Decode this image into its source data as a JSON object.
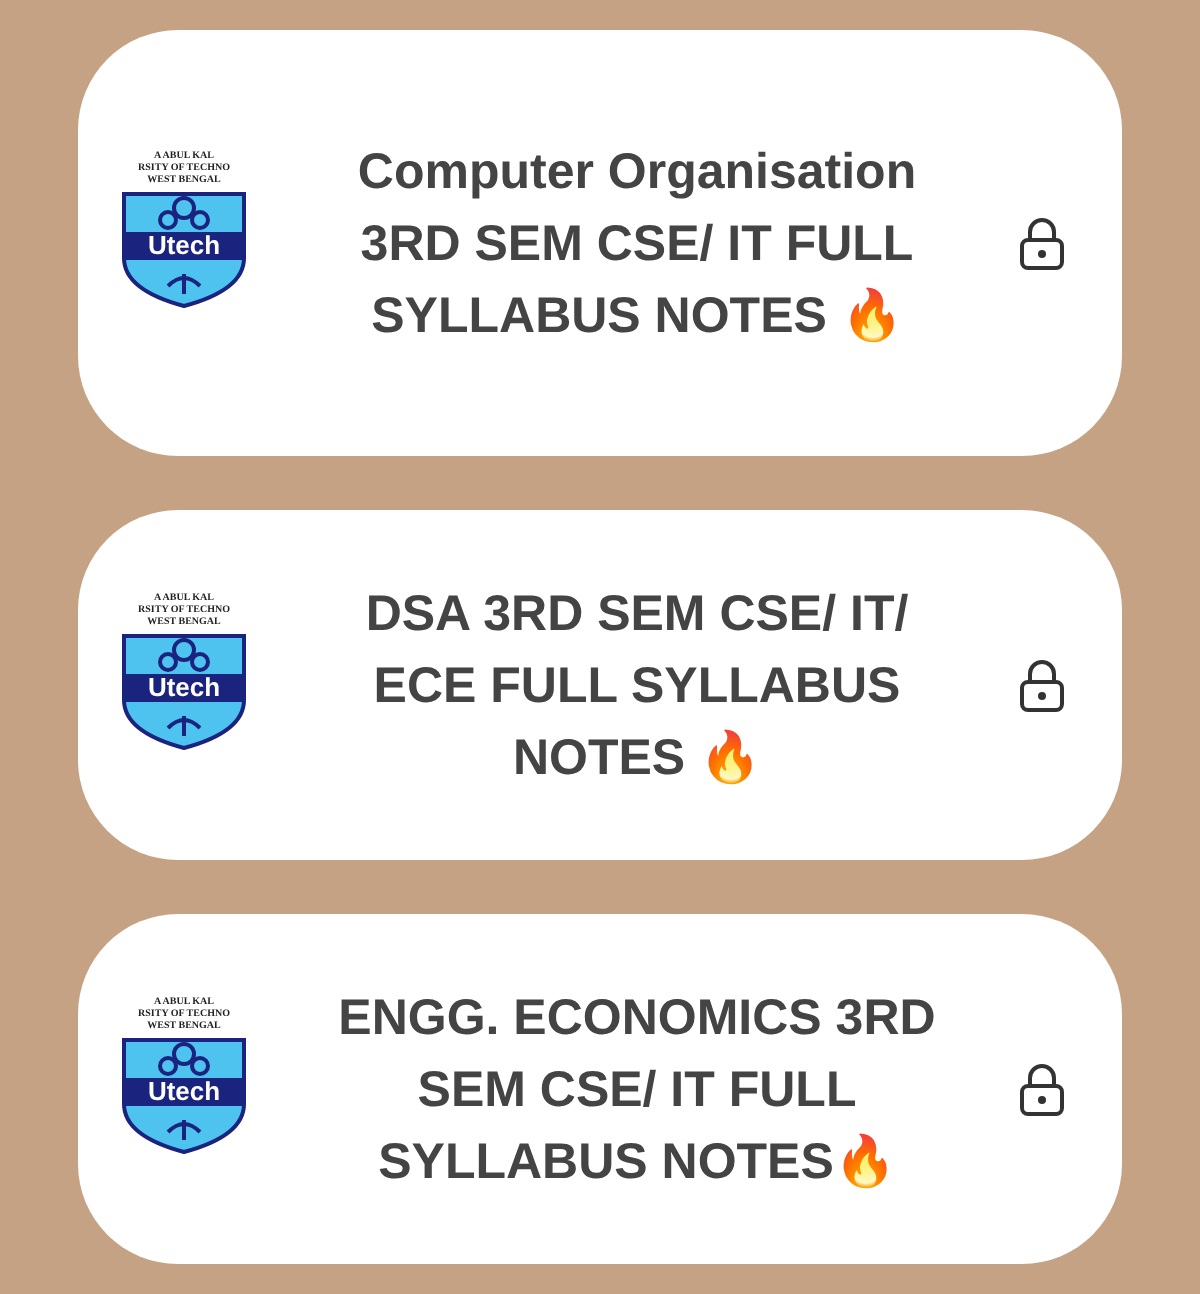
{
  "cards": [
    {
      "logo": {
        "lines": [
          "A ABUL KAL",
          "RSITY OF TECHNO",
          "WEST BENGAL"
        ],
        "name": "Utech"
      },
      "title": "Computer Organisation 3RD SEM CSE/ IT FULL SYLLABUS NOTES 🔥",
      "locked": true
    },
    {
      "logo": {
        "lines": [
          "A ABUL KAL",
          "RSITY OF TECHNO",
          "WEST BENGAL"
        ],
        "name": "Utech"
      },
      "title": "DSA 3RD SEM CSE/ IT/ ECE FULL SYLLABUS NOTES 🔥",
      "locked": true
    },
    {
      "logo": {
        "lines": [
          "A ABUL KAL",
          "RSITY OF TECHNO",
          "WEST BENGAL"
        ],
        "name": "Utech"
      },
      "title": "ENGG. ECONOMICS 3RD SEM CSE/ IT FULL SYLLABUS NOTES🔥",
      "locked": true
    }
  ]
}
